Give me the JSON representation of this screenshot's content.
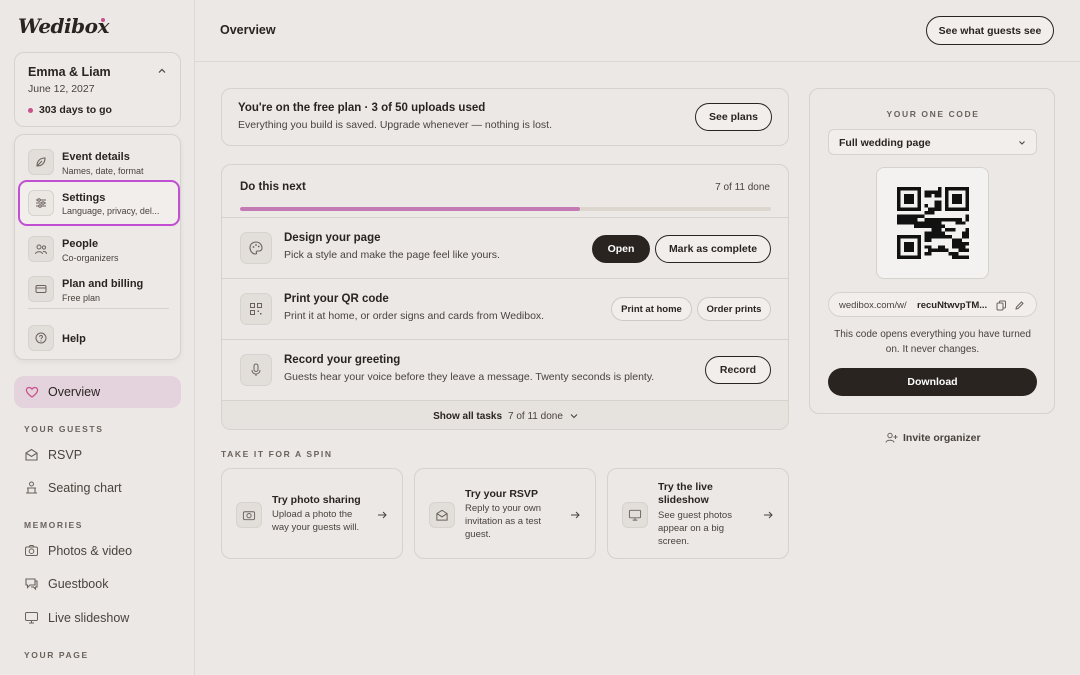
{
  "brand": {
    "name": "Wedibox",
    "accent": "#c7508d"
  },
  "event": {
    "name": "Emma & Liam",
    "date": "June 12, 2027",
    "countdown": "303 days to go"
  },
  "menu": {
    "items": [
      {
        "title": "Event details",
        "sub": "Names, date, format",
        "icon": "leaf-icon"
      },
      {
        "title": "Settings",
        "sub": "Language, privacy, del...",
        "icon": "sliders-icon"
      },
      {
        "title": "People",
        "sub": "Co-organizers",
        "icon": "people-icon"
      },
      {
        "title": "Plan and billing",
        "sub": "Free plan",
        "icon": "card-icon"
      },
      {
        "title": "Help",
        "sub": "",
        "icon": "help-icon"
      }
    ]
  },
  "nav": {
    "overview": "Overview",
    "your_guests_label": "YOUR GUESTS",
    "rsvp": "RSVP",
    "seating": "Seating chart",
    "memories_label": "MEMORIES",
    "photos": "Photos & video",
    "guestbook": "Guestbook",
    "slideshow": "Live slideshow",
    "your_page_label": "YOUR PAGE"
  },
  "header": {
    "title": "Overview",
    "guest_view": "See what guests see"
  },
  "plan": {
    "title": "You're on the free plan · 3 of 50 uploads used",
    "sub": "Everything you build is saved. Upgrade whenever — nothing is lost.",
    "button": "See plans"
  },
  "tasks": {
    "title": "Do this next",
    "count": "7 of 11 done",
    "progress": 0.64,
    "rows": [
      {
        "title": "Design your page",
        "sub": "Pick a style and make the page feel like yours.",
        "primary": "Open",
        "secondary": "Mark as complete"
      },
      {
        "title": "Print your QR code",
        "sub": "Print it at home, or order signs and cards from Wedibox.",
        "primary": "Print at home",
        "secondary": "Order prints"
      },
      {
        "title": "Record your greeting",
        "sub": "Guests hear your voice before they leave a message. Twenty seconds is plenty.",
        "primary": "Record"
      }
    ],
    "show_all": "Show all tasks",
    "show_all_count": "7 of 11 done"
  },
  "spin": {
    "label": "TAKE IT FOR A SPIN",
    "cards": [
      {
        "title": "Try photo sharing",
        "sub": "Upload a photo the way your guests will."
      },
      {
        "title": "Try your RSVP",
        "sub": "Reply to your own invitation as a test guest."
      },
      {
        "title": "Try the live slideshow",
        "sub": "See guest photos appear on a big screen."
      }
    ]
  },
  "code": {
    "label": "YOUR ONE CODE",
    "select": "Full wedding page",
    "url_prefix": "wedibox.com/w/",
    "url_code": "recuNtwvpTM...",
    "note": "This code opens everything you have turned on. It never changes.",
    "download": "Download",
    "invite": "Invite organizer"
  }
}
